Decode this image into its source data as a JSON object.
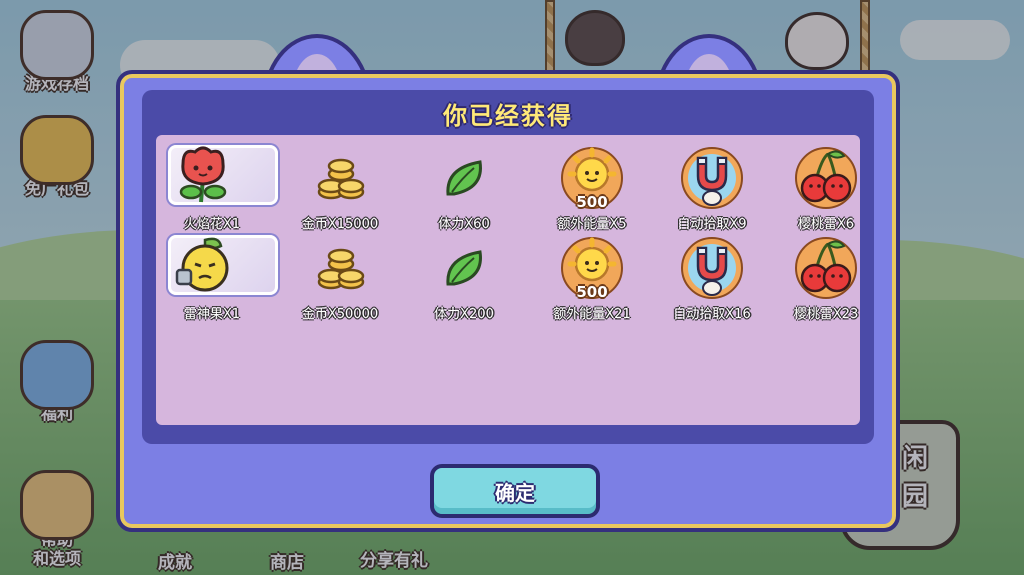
{
  "side_menu": [
    {
      "label": "游戏存档",
      "icon": "cloud-save-icon"
    },
    {
      "label": "免广礼包",
      "icon": "gift-box-icon"
    },
    {
      "label": "福利",
      "icon": "present-icon"
    },
    {
      "label": "帮助\n和选项",
      "icon": "wrench-icon"
    }
  ],
  "bottom_menu": [
    {
      "label": "成就"
    },
    {
      "label": "商店"
    },
    {
      "label": "分享有礼"
    }
  ],
  "garden_label": "闲园",
  "dialog": {
    "title": "你已经获得",
    "confirm_label": "确定",
    "rows": [
      [
        {
          "name": "火焰花",
          "label": "火焰花X1",
          "icon": "fire-flower-icon"
        },
        {
          "name": "金币",
          "label": "金币X15000",
          "icon": "gold-coins-icon"
        },
        {
          "name": "体力",
          "label": "体力X60",
          "icon": "leaf-icon"
        },
        {
          "name": "额外能量",
          "label": "额外能量X5",
          "icon": "sun-energy-icon",
          "badge": "500"
        },
        {
          "name": "自动拾取",
          "label": "自动拾取X9",
          "icon": "magnet-icon"
        },
        {
          "name": "樱桃雷",
          "label": "樱桃雷X6",
          "icon": "cherry-bomb-icon"
        }
      ],
      [
        {
          "name": "雷神果",
          "label": "雷神果X1",
          "icon": "thunder-fruit-icon"
        },
        {
          "name": "金币",
          "label": "金币X50000",
          "icon": "gold-coins-icon"
        },
        {
          "name": "体力",
          "label": "体力X200",
          "icon": "leaf-icon"
        },
        {
          "name": "额外能量",
          "label": "额外能量X21",
          "icon": "sun-energy-icon",
          "badge": "500"
        },
        {
          "name": "自动拾取",
          "label": "自动拾取X16",
          "icon": "magnet-icon"
        },
        {
          "name": "樱桃雷",
          "label": "樱桃雷X23",
          "icon": "cherry-bomb-icon"
        }
      ]
    ]
  },
  "colors": {
    "dialog_bg": "#7c7fe4",
    "panel_bg": "#4b4ba8",
    "paper_bg": "#d6b6dd",
    "title_text": "#ffe978",
    "confirm_bg": "#7fd8e1"
  }
}
